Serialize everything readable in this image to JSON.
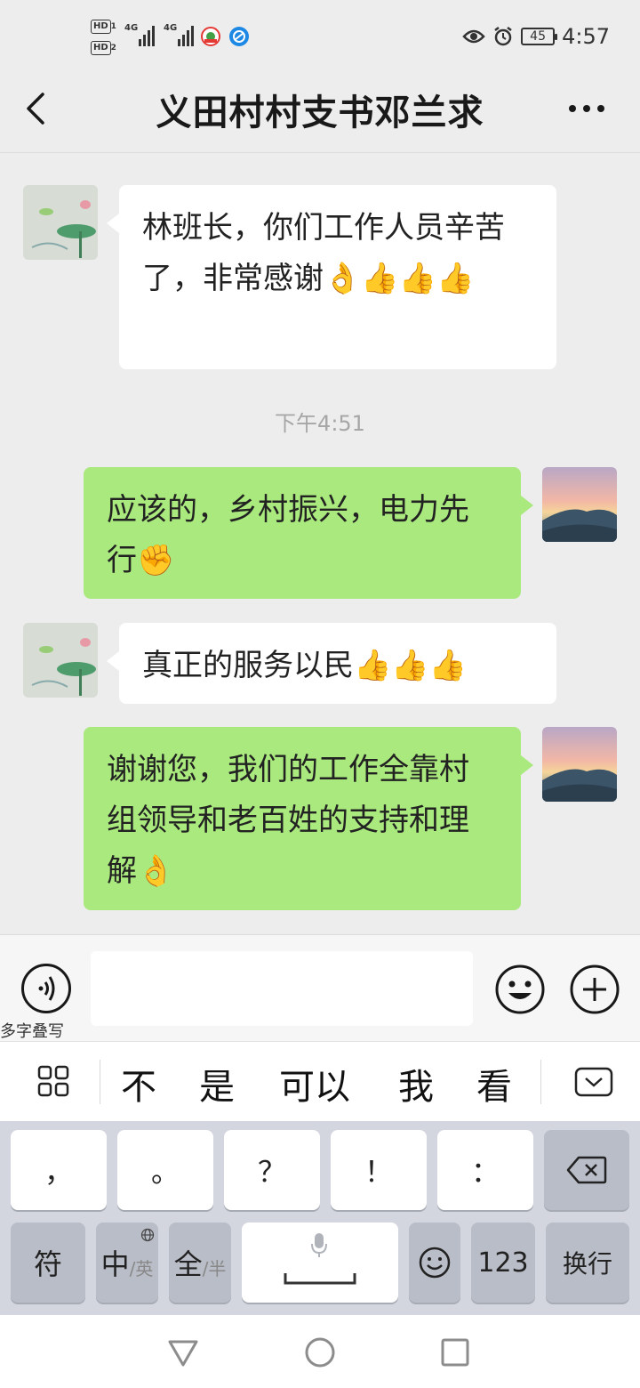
{
  "status_bar": {
    "hd1": "HD",
    "hd1_sub": "1",
    "hd2": "HD",
    "hd2_sub": "2",
    "net1": "4G",
    "net2": "4G",
    "battery": "45",
    "time": "4:57"
  },
  "header": {
    "title": "义田村村支书邓兰求",
    "back_icon": "chevron-left-icon",
    "more_icon": "ellipsis-icon"
  },
  "messages": [
    {
      "side": "left",
      "text": "林班长，你们工作人员辛苦了，非常感谢👌👍👍👍"
    },
    {
      "type": "timestamp",
      "text": "下午4:51"
    },
    {
      "side": "right",
      "text": "应该的，乡村振兴，电力先行✊"
    },
    {
      "side": "left",
      "text": "真正的服务以民👍👍👍"
    },
    {
      "side": "right",
      "text": "谢谢您，我们的工作全靠村组领导和老百姓的支持和理解👌"
    }
  ],
  "input_bar": {
    "voice_label": "多字叠写",
    "input_value": ""
  },
  "candidates": [
    "不",
    "是",
    "可以",
    "我",
    "看"
  ],
  "keyboard": {
    "row1": [
      "，",
      "。",
      "？",
      "！",
      "："
    ],
    "row2": {
      "symbol": "符",
      "lang_main": "中",
      "lang_sub": "/英",
      "width_main": "全",
      "width_sub": "/半",
      "emoji": "☺",
      "num": "123",
      "enter": "换行"
    }
  },
  "colors": {
    "background": "#ededed",
    "bubble_self": "#a9e97d",
    "bubble_other": "#ffffff",
    "keyboard": "#d3d6de"
  }
}
